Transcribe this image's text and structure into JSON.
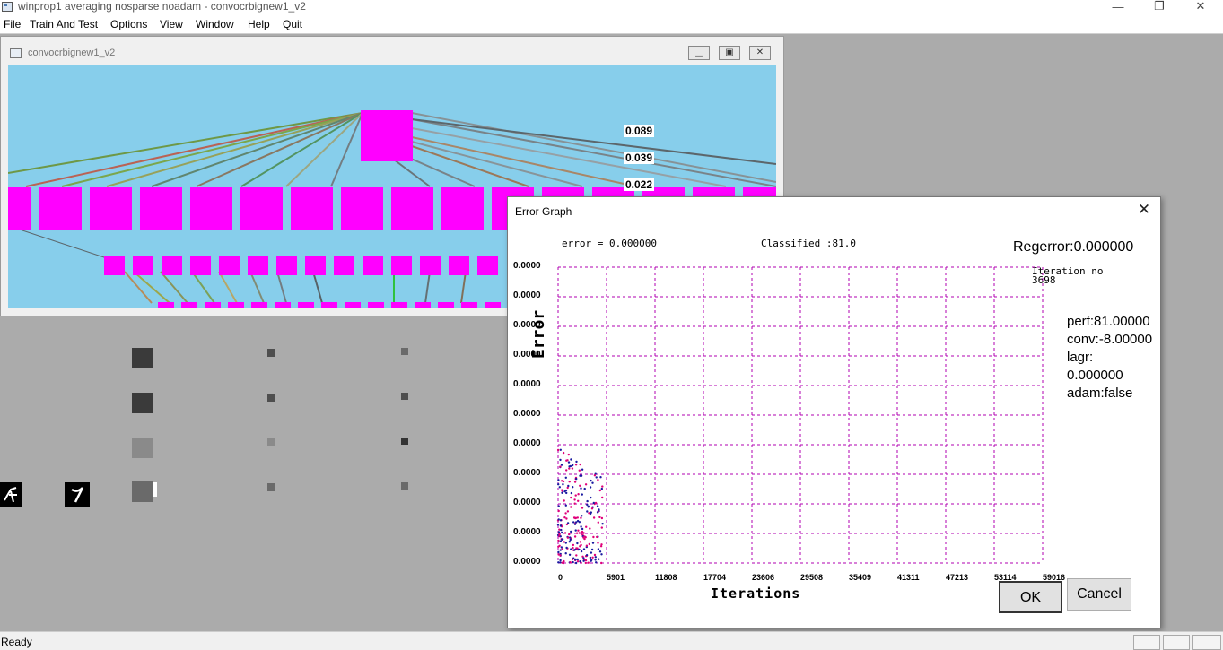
{
  "app": {
    "title": "winprop1 averaging nosparse noadam - convocrbignew1_v2",
    "window_controls": {
      "minimize": "—",
      "maximize": "❐",
      "close": "✕"
    }
  },
  "menu": [
    "File",
    "Train And Test",
    "Options",
    "View",
    "Window",
    "Help",
    "Quit"
  ],
  "network_window": {
    "title": "convocrbignew1_v2",
    "weight_labels": [
      "0.089",
      "0.039",
      "0.022"
    ],
    "colors": {
      "background": "#87ceeb",
      "node": "#ff00ff"
    }
  },
  "dialog": {
    "title": "Error Graph",
    "error_text": "error = 0.000000",
    "classified_text": "Classified :81.0",
    "regerror": "Regerror:0.000000",
    "iteration_label": "Iteration no",
    "iteration_value": "3698",
    "info": {
      "perf": "perf:81.00000",
      "conv": "conv:-8.00000",
      "lagr": "lagr:",
      "lagr_value": "0.000000",
      "adam": "adam:false"
    },
    "ok_label": "OK",
    "cancel_label": "Cancel"
  },
  "chart_data": {
    "type": "scatter",
    "xlabel": "Iterations",
    "ylabel": "Error",
    "x_ticks": [
      "0",
      "5901",
      "11808",
      "17704",
      "23606",
      "29508",
      "35409",
      "41311",
      "47213",
      "53114",
      "59016"
    ],
    "y_ticks": [
      "0.0000",
      "0.0000",
      "0.0000",
      "0.0000",
      "0.0000",
      "0.0000",
      "0.0000",
      "0.0000",
      "0.0000",
      "0.0000",
      "0.0000"
    ],
    "grid": true,
    "grid_color": "#b000b0",
    "point_colors": [
      "#e0007a",
      "#1a1aa0"
    ],
    "xlim": [
      0,
      59016
    ],
    "points_x_range": [
      0,
      5600
    ],
    "points_region": "bottom-left"
  },
  "status": {
    "text": "Ready"
  }
}
